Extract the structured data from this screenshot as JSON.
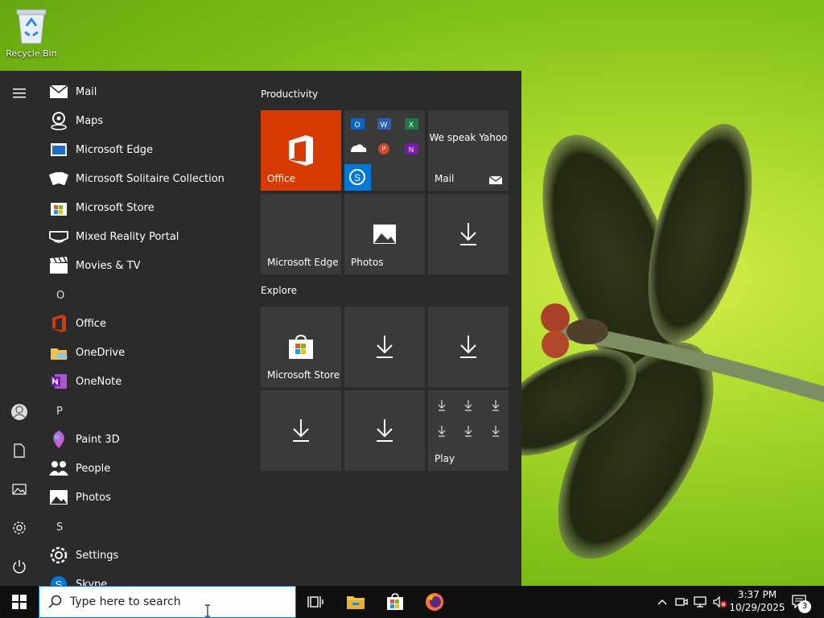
{
  "desktop": {
    "recycle_bin_label": "Recycle Bin"
  },
  "start_menu": {
    "apps": [
      {
        "label": "Mail",
        "icon": "mail-icon"
      },
      {
        "label": "Maps",
        "icon": "maps-icon"
      },
      {
        "label": "Microsoft Edge",
        "icon": "edge-icon"
      },
      {
        "label": "Microsoft Solitaire Collection",
        "icon": "solitaire-icon"
      },
      {
        "label": "Microsoft Store",
        "icon": "store-icon"
      },
      {
        "label": "Mixed Reality Portal",
        "icon": "mixed-reality-icon"
      },
      {
        "label": "Movies & TV",
        "icon": "movies-icon"
      },
      {
        "letter": "O"
      },
      {
        "label": "Office",
        "icon": "office-icon"
      },
      {
        "label": "OneDrive",
        "icon": "onedrive-icon"
      },
      {
        "label": "OneNote",
        "icon": "onenote-icon"
      },
      {
        "letter": "P"
      },
      {
        "label": "Paint 3D",
        "icon": "paint3d-icon"
      },
      {
        "label": "People",
        "icon": "people-icon"
      },
      {
        "label": "Photos",
        "icon": "photos-icon"
      },
      {
        "letter": "S"
      },
      {
        "label": "Settings",
        "icon": "settings-icon"
      },
      {
        "label": "Skype",
        "icon": "skype-icon"
      }
    ],
    "groups": {
      "productivity": "Productivity",
      "explore": "Explore"
    },
    "tiles": {
      "office": "Office",
      "mail_promo": "We speak Yahoo",
      "mail": "Mail",
      "edge": "Microsoft Edge",
      "photos": "Photos",
      "store": "Microsoft Store",
      "play": "Play"
    }
  },
  "taskbar": {
    "search_placeholder": "Type here to search",
    "time": "3:37 PM",
    "date": "10/29/2025",
    "notification_count": "3"
  },
  "colors": {
    "start_bg": "#2b2b2b",
    "tile_bg": "#3a3a3a",
    "office_orange": "#d83b01",
    "skype_blue": "#0078d7",
    "taskbar_bg": "#101010"
  }
}
